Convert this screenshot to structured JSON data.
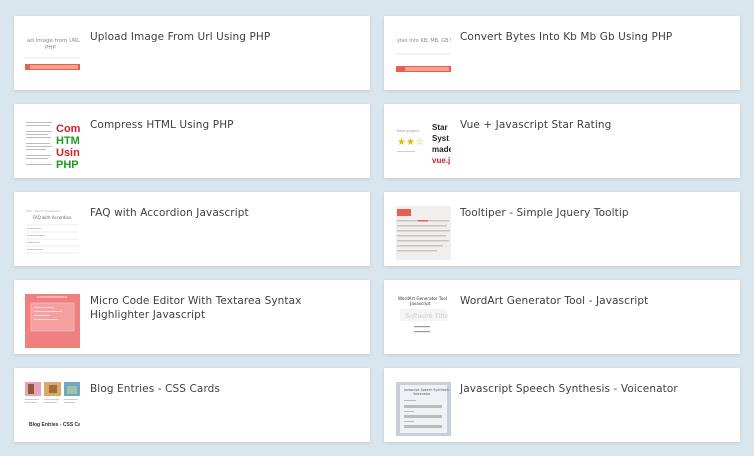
{
  "cards": [
    {
      "title": "Upload Image From Url Using PHP",
      "thumb_icon": "upload-image-thumbnail",
      "thumb_text": "ad Image from URL U\nPHP"
    },
    {
      "title": "Convert Bytes Into Kb Mb Gb Using PHP",
      "thumb_icon": "convert-bytes-thumbnail",
      "thumb_text": "ytes Into KB, MB, GB U"
    },
    {
      "title": "Compress HTML Using PHP",
      "thumb_icon": "compress-html-thumbnail",
      "thumb_text": "Com\nHTM\nUsin\nPHP"
    },
    {
      "title": "Vue + Javascript Star Rating",
      "thumb_icon": "star-rating-thumbnail",
      "thumb_text": "Star I\nSyste\nmade\nvue.j"
    },
    {
      "title": "FAQ with Accordion Javascript",
      "thumb_icon": "faq-accordion-thumbnail",
      "thumb_text": "FAQ with Accordion"
    },
    {
      "title": "Tooltiper - Simple Jquery Tooltip",
      "thumb_icon": "tooltiper-thumbnail",
      "thumb_text": ""
    },
    {
      "title": "Micro Code Editor With Textarea Syntax Highlighter Javascript",
      "thumb_icon": "code-editor-thumbnail",
      "thumb_text": ""
    },
    {
      "title": "WordArt Generator Tool - Javascript",
      "thumb_icon": "wordart-thumbnail",
      "thumb_text": "WordArt Generator Tool\nJavascript"
    },
    {
      "title": "Blog Entries - CSS Cards",
      "thumb_icon": "blog-entries-thumbnail",
      "thumb_text": "Blog Entries - CSS Cards"
    },
    {
      "title": "Javascript Speech Synthesis - Voicenator",
      "thumb_icon": "speech-synthesis-thumbnail",
      "thumb_text": ""
    }
  ],
  "colors": {
    "background": "#d9e6ee",
    "card": "#ffffff",
    "title_text": "#3c3f44",
    "accent_red": "#e8604c",
    "accent_pink": "#f08080"
  }
}
